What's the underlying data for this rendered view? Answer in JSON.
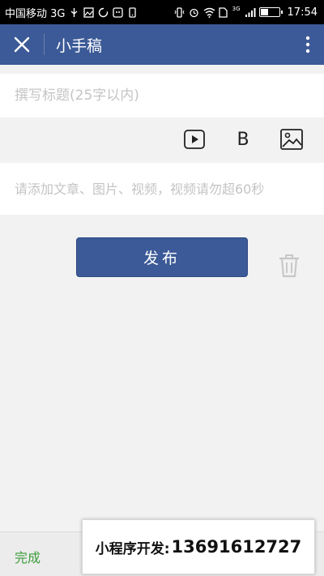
{
  "status_bar": {
    "carrier": "中国移动 3G",
    "time": "17:54",
    "network_badge": "3G",
    "battery_level": 0.45
  },
  "nav": {
    "title": "小手稿",
    "close_icon": "close-icon",
    "more_icon": "more-vertical-icon"
  },
  "editor": {
    "title_placeholder": "撰写标题(25字以内)",
    "title_value": "",
    "content_placeholder": "请添加文章、图片、视频，视频请勿超60秒",
    "content_value": "",
    "toolbar": {
      "video_icon": "video-play-icon",
      "bold_label": "B",
      "image_icon": "image-icon"
    }
  },
  "actions": {
    "publish_label": "发布",
    "delete_icon": "trash-icon"
  },
  "bottom": {
    "done_label": "完成"
  },
  "promo": {
    "label": "小程序开发:",
    "number": "13691612727"
  },
  "colors": {
    "accent": "#3c5a97",
    "done_green": "#3a9c3a"
  }
}
